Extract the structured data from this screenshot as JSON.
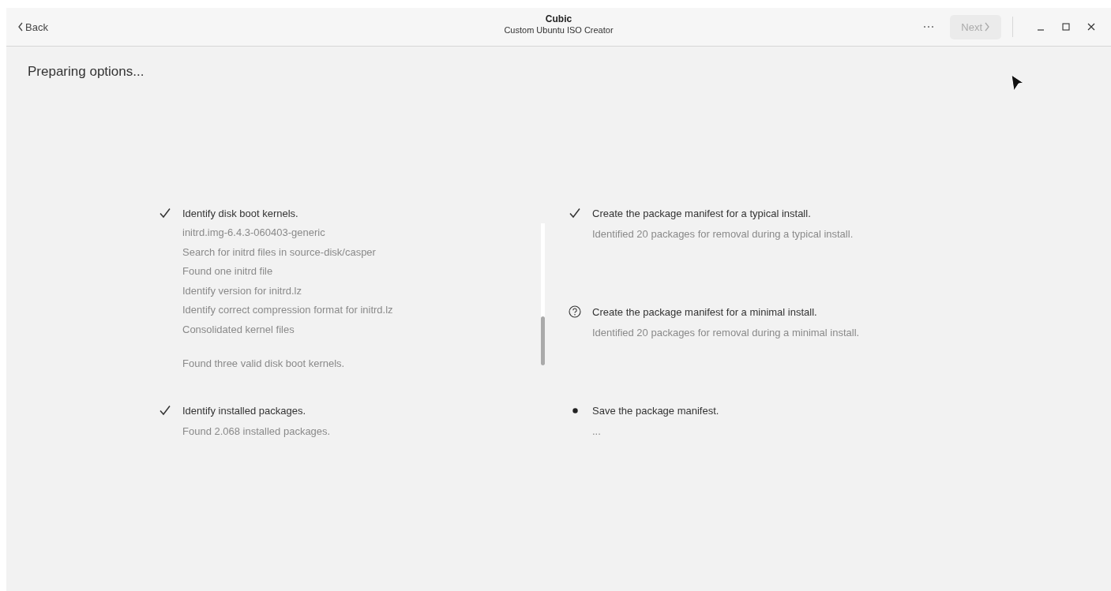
{
  "window": {
    "title": "Cubic",
    "subtitle": "Custom Ubuntu ISO Creator"
  },
  "header": {
    "back": {
      "label": "Back",
      "disabled": false
    },
    "next": {
      "label": "Next",
      "disabled": true
    }
  },
  "page": {
    "heading": "Preparing options..."
  },
  "columns": [
    {
      "tasks": [
        {
          "kind": "done",
          "title": "Identify disk boot kernels.",
          "log": [
            "initrd.img-6.4.3-060403-generic",
            "Search for initrd files in source-disk/casper",
            "Found one initrd file",
            "Identify version for initrd.lz",
            "Identify correct compression format for initrd.lz",
            "Consolidated kernel files"
          ],
          "result": "Found three valid disk boot kernels."
        },
        {
          "kind": "done",
          "title": "Identify installed packages.",
          "result": "Found 2.068 installed packages."
        }
      ]
    },
    {
      "tasks": [
        {
          "kind": "done",
          "title": "Create the package manifest for a typical install.",
          "result": "Identified 20 packages for removal during a typical install."
        },
        {
          "kind": "question",
          "title": "Create the package manifest for a minimal install.",
          "result": "Identified 20 packages for removal during a minimal install."
        },
        {
          "kind": "running",
          "title": "Save the package manifest.",
          "result": "..."
        }
      ]
    }
  ]
}
